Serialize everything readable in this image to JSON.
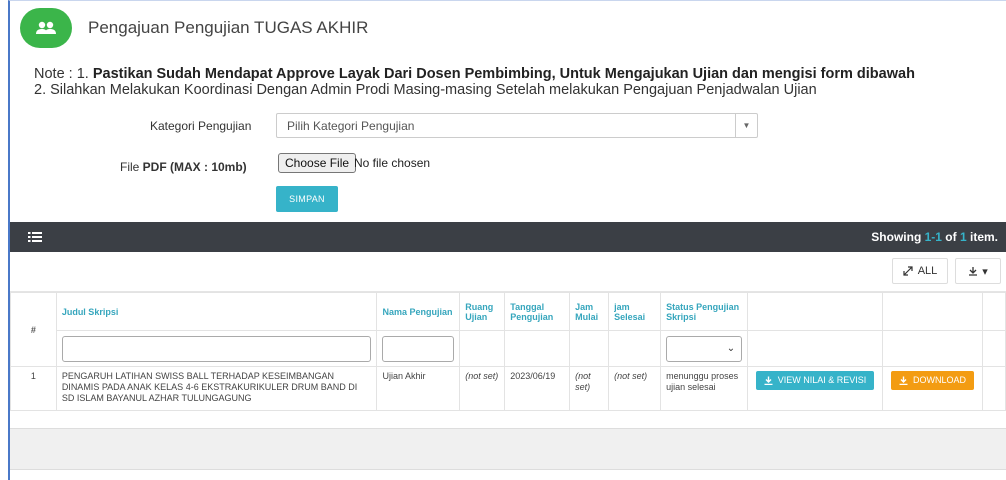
{
  "header": {
    "title": "Pengajuan Pengujian TUGAS AKHIR",
    "icon": "users-icon",
    "icon_color": "#3bb54a"
  },
  "note": {
    "prefix": "Note : 1. ",
    "line1_bold": "Pastikan Sudah Mendapat Approve Layak Dari Dosen Pembimbing, Untuk Mengajukan Ujian dan mengisi form dibawah",
    "line2": "2. Silahkan Melakukan Koordinasi Dengan Admin Prodi Masing-masing Setelah melakukan Pengajuan Penjadwalan Ujian"
  },
  "form": {
    "kategori_label": "Kategori Pengujian",
    "kategori_placeholder": "Pilih Kategori Pengujian",
    "file_label_prefix": "File ",
    "file_label_bold": "PDF (MAX : 10mb)",
    "choose_file_label": "Choose File",
    "no_file_text": "No file chosen",
    "submit_label": "SIMPAN"
  },
  "toolbar": {
    "showing_prefix": "Showing ",
    "showing_range": "1-1",
    "showing_of": " of ",
    "showing_total": "1",
    "showing_suffix": " item.",
    "all_label": "ALL"
  },
  "table": {
    "headers": {
      "num": "#",
      "judul": "Judul Skripsi",
      "nama": "Nama Pengujian",
      "ruang": "Ruang Ujian",
      "tanggal": "Tanggal Pengujian",
      "jam_mulai": "Jam Mulai",
      "jam_selesai": "jam Selesai",
      "status": "Status Pengujian Skripsi"
    },
    "rows": [
      {
        "num": "1",
        "judul": "PENGARUH LATIHAN SWISS BALL TERHADAP KESEIMBANGAN DINAMIS PADA ANAK KELAS 4-6 EKSTRAKURIKULER DRUM BAND DI SD ISLAM BAYANUL AZHAR TULUNGAGUNG",
        "nama": "Ujian Akhir",
        "ruang": "(not set)",
        "tanggal": "2023/06/19",
        "jam_mulai": "(not set)",
        "jam_selesai": "(not set)",
        "status": "menunggu proses ujian selesai",
        "view_label": "VIEW NILAI & REVISI",
        "download_label": "DOWNLOAD"
      }
    ]
  },
  "colors": {
    "accent": "#36b3c9",
    "download": "#f39c12",
    "toolbar_bg": "#3b3f45",
    "not_set": "#cc3333"
  }
}
